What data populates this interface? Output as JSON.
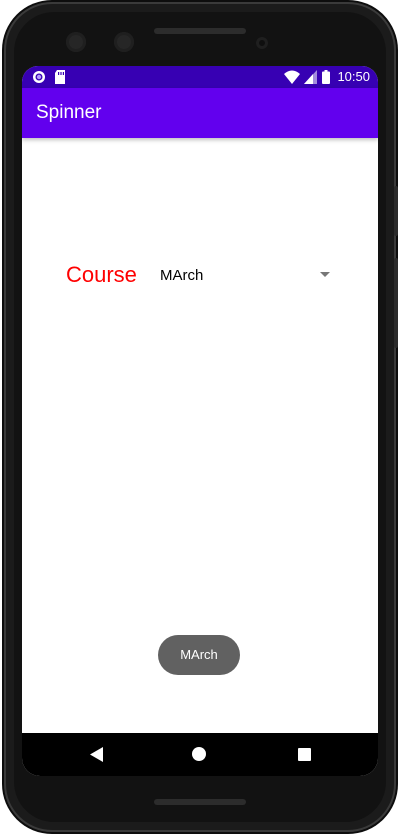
{
  "status_bar": {
    "time": "10:50",
    "icons": [
      "record-circle-icon",
      "sd-card-icon",
      "wifi-icon",
      "cell-signal-icon",
      "battery-icon"
    ]
  },
  "app_bar": {
    "title": "Spinner",
    "color": "#6200ee",
    "status_color": "#3700b3"
  },
  "form": {
    "course_label": "Course",
    "course_label_color": "#ff0000",
    "spinner_selected": "MArch"
  },
  "toast": {
    "text": "MArch"
  },
  "nav_bar": {
    "icons": [
      "back-icon",
      "home-icon",
      "recents-icon"
    ]
  }
}
